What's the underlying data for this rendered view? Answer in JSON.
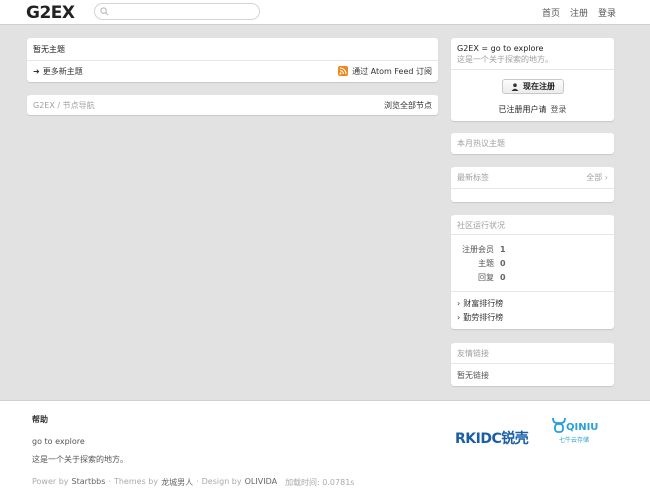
{
  "header": {
    "logo": "G2EX",
    "search_placeholder": "",
    "nav": [
      "首页",
      "注册",
      "登录"
    ]
  },
  "main": {
    "topics_title": "暂无主题",
    "more_topics": "更多新主题",
    "atom_feed": "通过 Atom Feed 订阅",
    "nodes_breadcrumb": "G2EX / 节点导航",
    "browse_nodes": "浏览全部节点"
  },
  "sidebar": {
    "intro_title": "G2EX = go to explore",
    "intro_desc": "这是一个关于探索的地方。",
    "register_button": "现在注册",
    "registered_prompt": "已注册用户请",
    "login_link": "登录",
    "hot_topics": "本月热议主题",
    "hot_tags": "最新标签",
    "all_tags": "全部 ›",
    "community_status": "社区运行状况",
    "stats": [
      {
        "label": "注册会员",
        "value": "1"
      },
      {
        "label": "主题",
        "value": "0"
      },
      {
        "label": "回复",
        "value": "0"
      }
    ],
    "rank_wealth": "财富排行榜",
    "rank_active": "勤劳排行榜",
    "friend_links": "友情链接",
    "no_links": "暂无链接"
  },
  "footer": {
    "help": "帮助",
    "tagline": "go to explore",
    "desc": "这是一个关于探索的地方。",
    "power_prefix": "Power by",
    "startbbs": "Startbbs",
    "themes_prefix": "Themes by",
    "theme_author": "龙城男人",
    "design_prefix": "Design by",
    "designer": "OLIVIDA",
    "load_time": "加载时间: 0.0781s",
    "sponsor_rk": "RKIDC锐壳",
    "sponsor_qiniu": "QINIU",
    "sponsor_qiniu_sub": "七牛云存储"
  },
  "colors": {
    "background": "#e2e2e2",
    "rss": "#f0891c",
    "rk_blue": "#1a5ea8",
    "qiniu_blue": "#25a0d8"
  }
}
